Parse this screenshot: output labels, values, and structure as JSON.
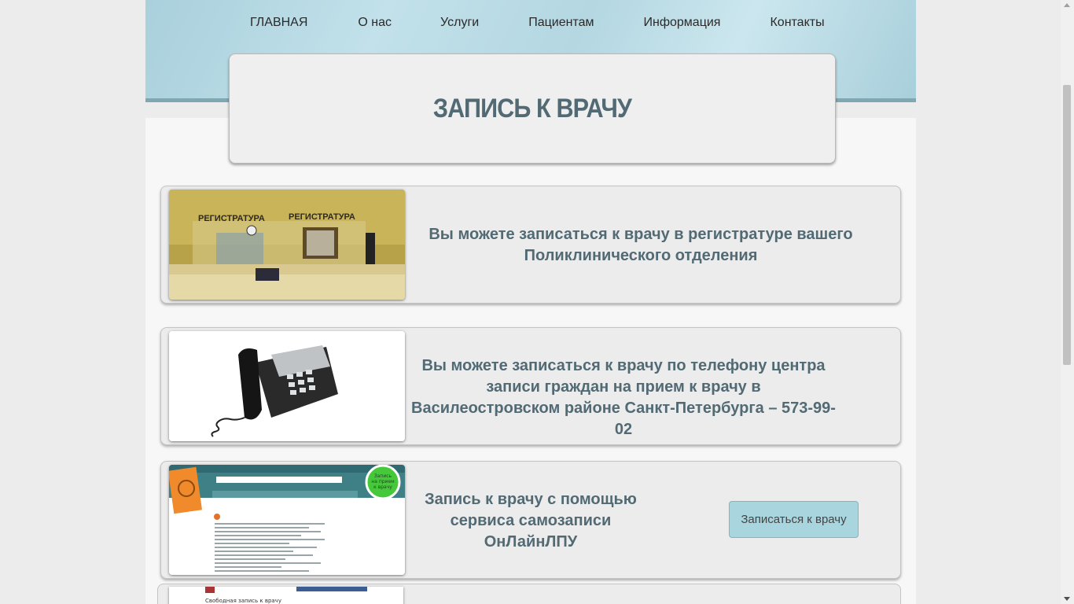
{
  "nav": {
    "items": [
      "ГЛАВНАЯ",
      "О нас",
      "Услуги",
      "Пациентам",
      "Информация",
      "Контакты"
    ]
  },
  "page_title": "ЗАПИСЬ К ВРАЧУ",
  "cards": [
    {
      "text": "Вы можете записаться к врачу в регистратуре вашего Поликлинического отделения",
      "image_sign": "РЕГИСТРАТУРА"
    },
    {
      "text": "Вы можете записаться к врачу по телефону центра записи граждан на прием к врачу в Василеостровском районе Санкт-Петербурга – 573-99-02"
    },
    {
      "text": "Запись к врачу с помощью сервиса самозаписи ОнЛайнЛПУ",
      "button_label": "Записаться к врачу",
      "badge": "Запись на прием к врачу"
    }
  ],
  "card4_partial_text": "Свободная запись к врачу",
  "colors": {
    "accent": "#526a74",
    "header_bg": "#b4d7e2",
    "button_bg": "#a9d5df"
  },
  "icons": [
    "phone-icon"
  ]
}
